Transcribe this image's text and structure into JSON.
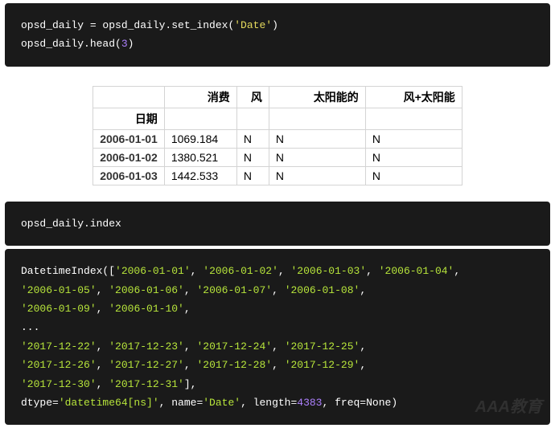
{
  "code_block_1": {
    "text_a": "opsd_daily = opsd_daily.set_index(",
    "str_date": "'Date'",
    "text_b": ")",
    "line2_a": "opsd_daily.head(",
    "line2_n": "3",
    "line2_b": ")"
  },
  "table": {
    "corner": "",
    "date_label": "日期",
    "headers": [
      "消费",
      "风",
      "太阳能的",
      "风+太阳能"
    ],
    "rows": [
      {
        "idx": "2006-01-01",
        "cells": [
          "1069.184",
          "N",
          "N",
          "N"
        ]
      },
      {
        "idx": "2006-01-02",
        "cells": [
          "1380.521",
          "N",
          "N",
          "N"
        ]
      },
      {
        "idx": "2006-01-03",
        "cells": [
          "1442.533",
          "N",
          "N",
          "N"
        ]
      }
    ]
  },
  "code_block_2": {
    "line": "opsd_daily.index"
  },
  "output": {
    "line1_pre": "DatetimeIndex([",
    "line1_dates": [
      "'2006-01-01'",
      "'2006-01-02'",
      "'2006-01-03'",
      "'2006-01-04'"
    ],
    "line2_dates": [
      "'2006-01-05'",
      "'2006-01-06'",
      "'2006-01-07'",
      "'2006-01-08'"
    ],
    "line3_dates": [
      "'2006-01-09'",
      "'2006-01-10'"
    ],
    "ellipsis": "...",
    "line5_dates": [
      "'2017-12-22'",
      "'2017-12-23'",
      "'2017-12-24'",
      "'2017-12-25'"
    ],
    "line6_dates": [
      "'2017-12-26'",
      "'2017-12-27'",
      "'2017-12-28'",
      "'2017-12-29'"
    ],
    "line7_dates": [
      "'2017-12-30'",
      "'2017-12-31'"
    ],
    "line7_post": "],",
    "last_pre": "dtype=",
    "last_dtype": "'datetime64[ns]'",
    "last_mid1": ", name=",
    "last_name": "'Date'",
    "last_mid2": ", length=",
    "last_len": "4383",
    "last_post": ", freq=None)"
  },
  "watermark": "AAA教育"
}
